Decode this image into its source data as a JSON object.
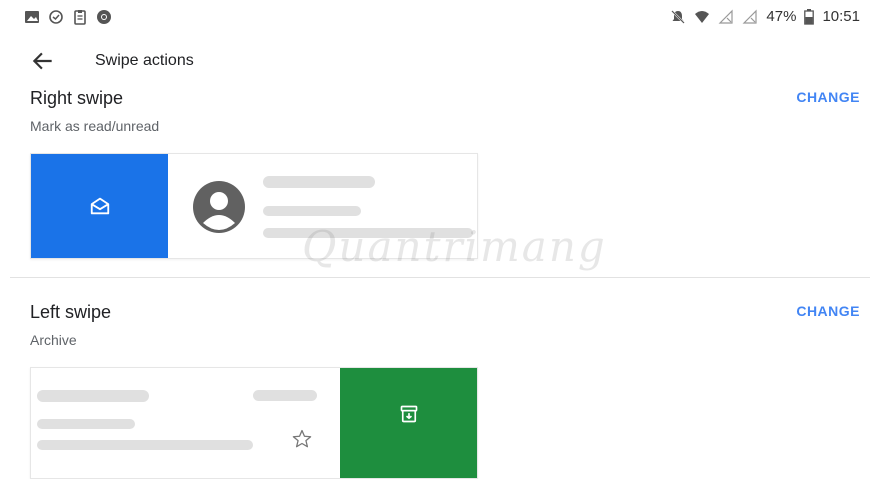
{
  "status_bar": {
    "battery": "47%",
    "time": "10:51",
    "left_icons": [
      "image-icon",
      "circle-check-icon",
      "clipboard-icon",
      "chrome-icon"
    ],
    "right_icons": [
      "bell-off-icon",
      "wifi-icon",
      "signal-off-icon",
      "signal-off-icon",
      "battery-icon"
    ]
  },
  "header": {
    "title": "Swipe actions"
  },
  "right_swipe": {
    "title": "Right swipe",
    "subtitle": "Mark as read/unread",
    "change_label": "CHANGE",
    "action_color": "#1a73e8",
    "action_icon": "mail-open-icon"
  },
  "left_swipe": {
    "title": "Left swipe",
    "subtitle": "Archive",
    "change_label": "CHANGE",
    "action_color": "#1e8e3e",
    "action_icon": "archive-icon"
  },
  "watermark": "Quantrimang",
  "colors": {
    "accent": "#4285f4",
    "placeholder_bar": "#e0e0e0"
  }
}
